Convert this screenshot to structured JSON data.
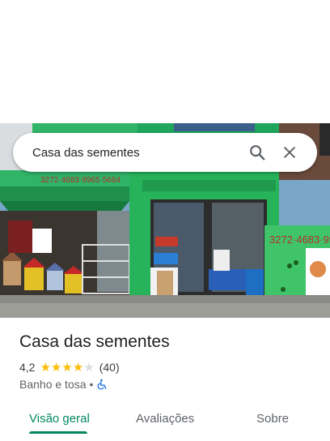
{
  "search": {
    "query": "Casa das sementes"
  },
  "photo": {
    "phone_sign": "3272·4683·99",
    "awning_text": "3272·4683·9965·5664"
  },
  "place": {
    "name": "Casa das sementes",
    "rating": "4,2",
    "stars": 4.2,
    "review_count": "(40)",
    "category": "Banho e tosa",
    "separator": "•"
  },
  "tabs": [
    {
      "label": "Visão geral",
      "active": true
    },
    {
      "label": "Avaliações",
      "active": false
    },
    {
      "label": "Sobre",
      "active": false
    }
  ],
  "colors": {
    "accent": "#01875f",
    "star": "#fbbc04",
    "wall_green": "#27b35a"
  }
}
